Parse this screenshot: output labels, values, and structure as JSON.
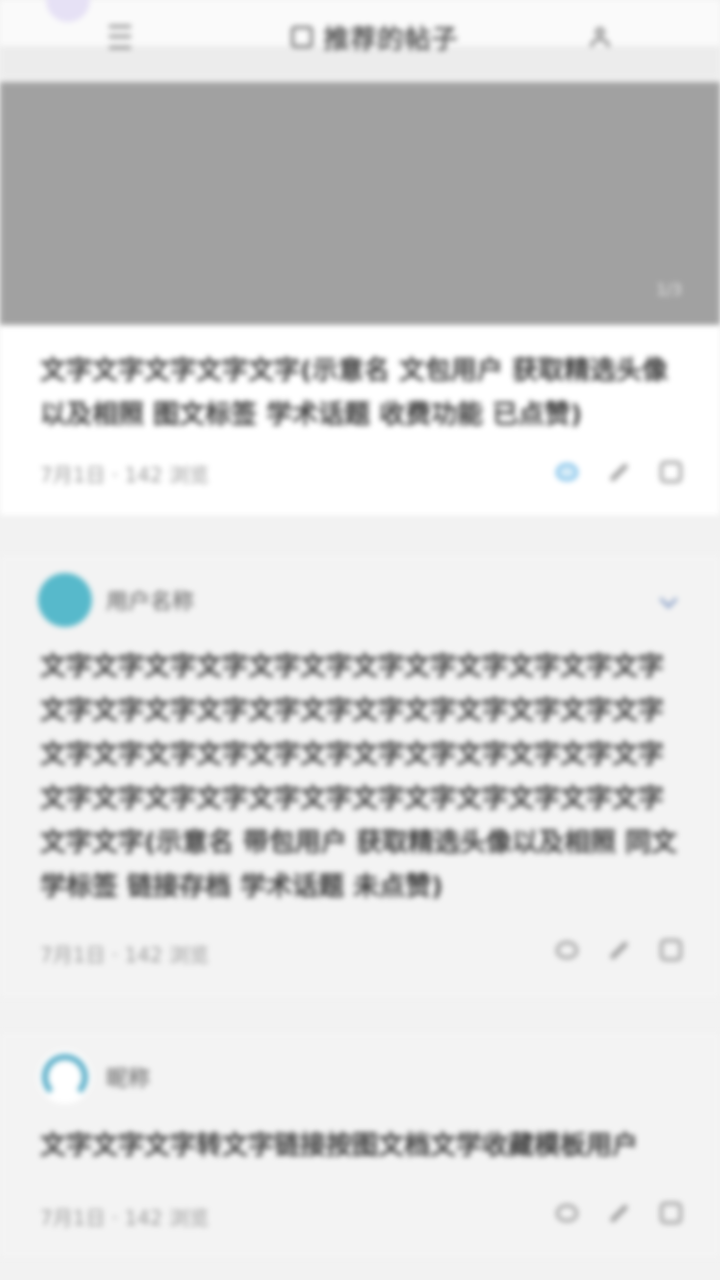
{
  "toolbar": {
    "title": "推荐的帖子"
  },
  "media": {
    "counter": "1/3"
  },
  "posts": [
    {
      "text": "文字文字文字文字文字(示意名 文包用户 获取精选头像以及相照 图文标签 学术话题 收费功能 已点赞)",
      "meta": "7月1日 · 142 浏览",
      "liked": true
    },
    {
      "username": "用户名称",
      "text": "文字文字文字文字文字文字文字文字文字文字文字文字文字文字文字文字文字文字文字文字文字文字文字文字文字文字文字文字文字文字文字文字文字文字文字文字文字文字文字文字文字文字文字文字文字文字文字文字文字文字(示意名 带包用户 获取精选头像以及相照 同文学标签 链接存档 学术话题 未点赞)",
      "meta": "7月1日 · 142 浏览",
      "liked": false
    },
    {
      "username": "昵称",
      "text": "文字文字文字转文字链接按图文档文学收藏模板用户",
      "meta": "7月1日 · 142 浏览",
      "liked": false
    }
  ],
  "colors": {
    "accent": "#57b9cb",
    "like": "#78bde8",
    "media_placeholder": "#a1a1a1"
  },
  "icons": [
    "menu-icon",
    "square-icon",
    "person-icon",
    "heart-icon",
    "edit-icon",
    "comment-icon",
    "chevron-down-icon"
  ]
}
